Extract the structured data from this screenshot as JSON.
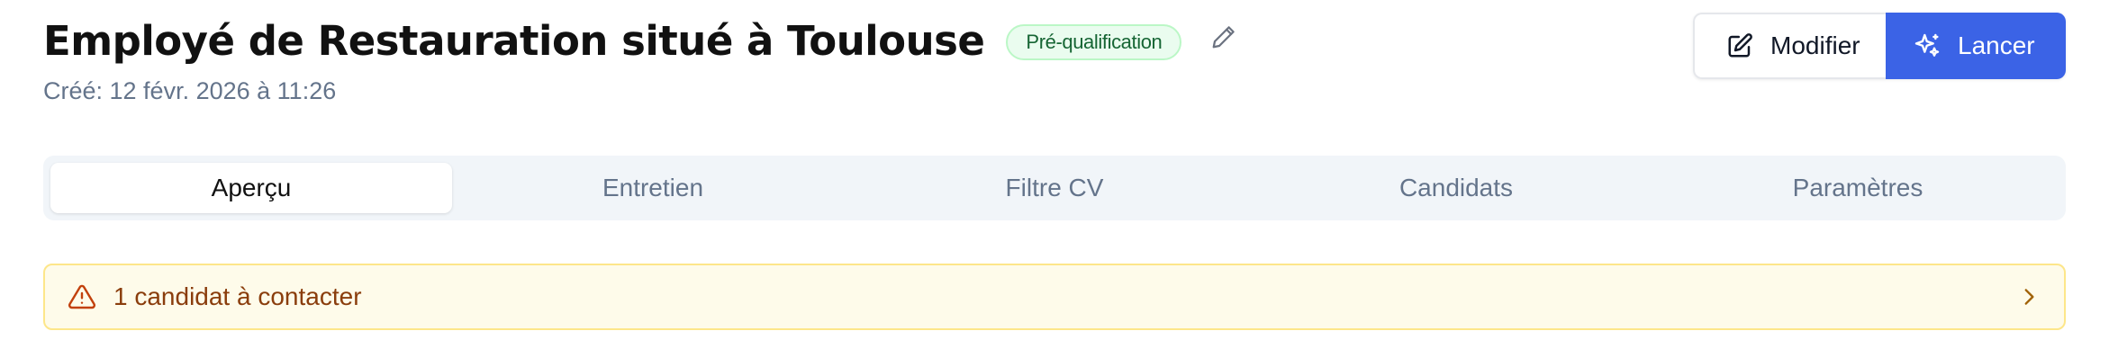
{
  "header": {
    "title": "Employé de Restauration situé à Toulouse",
    "status_badge": "Pré-qualification",
    "created": "Créé: 12 févr. 2026 à 11:26",
    "icons": {
      "edit_title": "pencil-icon"
    }
  },
  "actions": {
    "modify_label": "Modifier",
    "modify_icon": "edit-square-icon",
    "launch_label": "Lancer",
    "launch_icon": "sparkles-icon"
  },
  "tabs": [
    {
      "label": "Aperçu",
      "active": true
    },
    {
      "label": "Entretien",
      "active": false
    },
    {
      "label": "Filtre CV",
      "active": false
    },
    {
      "label": "Candidats",
      "active": false
    },
    {
      "label": "Paramètres",
      "active": false
    }
  ],
  "alert": {
    "text": "1 candidat à contacter",
    "icon": "warning-triangle-icon",
    "action_icon": "chevron-right-icon"
  },
  "colors": {
    "accent": "#3b63e6",
    "badge_bg": "#eafcef",
    "badge_text": "#166534",
    "alert_bg": "#fefbea",
    "alert_border": "#fde68a",
    "alert_text": "#8a3d0c",
    "muted_text": "#64748b",
    "tabs_bg": "#f1f5f9"
  }
}
